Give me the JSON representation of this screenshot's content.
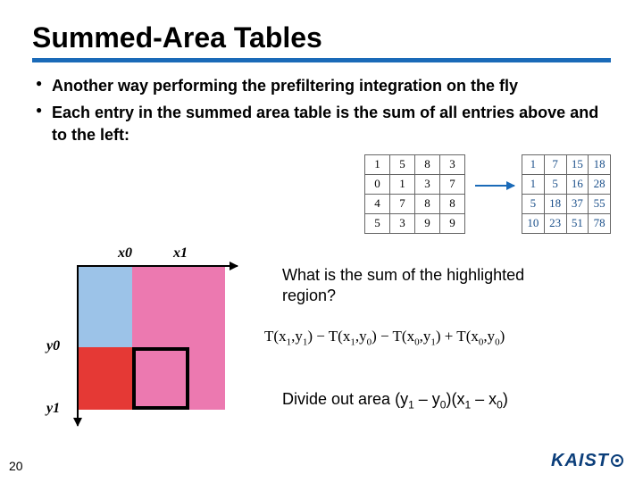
{
  "title": "Summed-Area Tables",
  "bullets": [
    "Another way performing the prefiltering integration on the fly",
    "Each entry in the summed area table is the sum of all entries above and to the left:"
  ],
  "chart_data": [
    {
      "type": "table",
      "title": "source",
      "rows": [
        [
          1,
          5,
          8,
          3
        ],
        [
          0,
          1,
          3,
          7
        ],
        [
          4,
          7,
          8,
          8
        ],
        [
          5,
          3,
          9,
          9
        ]
      ]
    },
    {
      "type": "table",
      "title": "summed_area",
      "rows": [
        [
          1,
          7,
          15,
          18
        ],
        [
          1,
          5,
          16,
          28
        ],
        [
          5,
          18,
          37,
          55
        ],
        [
          10,
          23,
          51,
          78
        ]
      ]
    }
  ],
  "diagram": {
    "x_labels": [
      "x0",
      "x1"
    ],
    "y_labels": [
      "y0",
      "y1"
    ]
  },
  "question": "What is the sum of the highlighted region?",
  "formula_parts": {
    "t": "T",
    "x1": "x",
    "x1s": "1",
    "y1": "y",
    "y1s": "1",
    "x0": "x",
    "x0s": "0",
    "y0": "y",
    "y0s": "0",
    "comma": ",",
    "lp": "(",
    "rp": ")",
    "minus": " − ",
    "plus": " + "
  },
  "divide_text_a": "Divide out area (y",
  "divide_text_b": " – y",
  "divide_text_c": ")(x",
  "divide_text_d": " – x",
  "divide_text_e": ")",
  "sub1": "1",
  "sub0": "0",
  "page_number": "20",
  "logo_text": "KAIST"
}
